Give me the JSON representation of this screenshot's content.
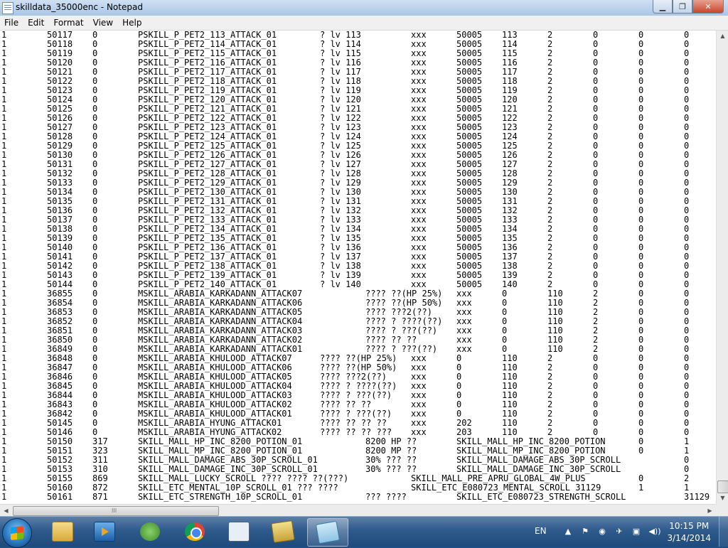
{
  "window": {
    "title": "skilldata_35000enc - Notepad",
    "minimize_glyph": "▁",
    "maximize_glyph": "❐",
    "close_glyph": "✕"
  },
  "menu": [
    "File",
    "Edit",
    "Format",
    "View",
    "Help"
  ],
  "scroll_glyphs": {
    "up": "▲",
    "down": "▼",
    "left": "◀",
    "right": "▶",
    "grip": "III"
  },
  "lines": [
    {
      "cells": [
        "1",
        "50117",
        "0",
        "PSKILL_P_PET2_113_ATTACK_01",
        "? lv 113",
        "xxx",
        "50005",
        "113",
        "2",
        "0",
        "0",
        "0"
      ]
    },
    {
      "cells": [
        "1",
        "50118",
        "0",
        "PSKILL_P_PET2_114_ATTACK_01",
        "? lv 114",
        "xxx",
        "50005",
        "114",
        "2",
        "0",
        "0",
        "0"
      ]
    },
    {
      "cells": [
        "1",
        "50119",
        "0",
        "PSKILL_P_PET2_115_ATTACK_01",
        "? lv 115",
        "xxx",
        "50005",
        "115",
        "2",
        "0",
        "0",
        "0"
      ]
    },
    {
      "cells": [
        "1",
        "50120",
        "0",
        "PSKILL_P_PET2_116_ATTACK_01",
        "? lv 116",
        "xxx",
        "50005",
        "116",
        "2",
        "0",
        "0",
        "0"
      ]
    },
    {
      "cells": [
        "1",
        "50121",
        "0",
        "PSKILL_P_PET2_117_ATTACK_01",
        "? lv 117",
        "xxx",
        "50005",
        "117",
        "2",
        "0",
        "0",
        "0"
      ]
    },
    {
      "cells": [
        "1",
        "50122",
        "0",
        "PSKILL_P_PET2_118_ATTACK_01",
        "? lv 118",
        "xxx",
        "50005",
        "118",
        "2",
        "0",
        "0",
        "0"
      ]
    },
    {
      "cells": [
        "1",
        "50123",
        "0",
        "PSKILL_P_PET2_119_ATTACK_01",
        "? lv 119",
        "xxx",
        "50005",
        "119",
        "2",
        "0",
        "0",
        "0"
      ]
    },
    {
      "cells": [
        "1",
        "50124",
        "0",
        "PSKILL_P_PET2_120_ATTACK_01",
        "? lv 120",
        "xxx",
        "50005",
        "120",
        "2",
        "0",
        "0",
        "0"
      ]
    },
    {
      "cells": [
        "1",
        "50125",
        "0",
        "PSKILL_P_PET2_121_ATTACK_01",
        "? lv 121",
        "xxx",
        "50005",
        "121",
        "2",
        "0",
        "0",
        "0"
      ]
    },
    {
      "cells": [
        "1",
        "50126",
        "0",
        "PSKILL_P_PET2_122_ATTACK_01",
        "? lv 122",
        "xxx",
        "50005",
        "122",
        "2",
        "0",
        "0",
        "0"
      ]
    },
    {
      "cells": [
        "1",
        "50127",
        "0",
        "PSKILL_P_PET2_123_ATTACK_01",
        "? lv 123",
        "xxx",
        "50005",
        "123",
        "2",
        "0",
        "0",
        "0"
      ]
    },
    {
      "cells": [
        "1",
        "50128",
        "0",
        "PSKILL_P_PET2_124_ATTACK_01",
        "? lv 124",
        "xxx",
        "50005",
        "124",
        "2",
        "0",
        "0",
        "0"
      ]
    },
    {
      "cells": [
        "1",
        "50129",
        "0",
        "PSKILL_P_PET2_125_ATTACK_01",
        "? lv 125",
        "xxx",
        "50005",
        "125",
        "2",
        "0",
        "0",
        "0"
      ]
    },
    {
      "cells": [
        "1",
        "50130",
        "0",
        "PSKILL_P_PET2_126_ATTACK_01",
        "? lv 126",
        "xxx",
        "50005",
        "126",
        "2",
        "0",
        "0",
        "0"
      ]
    },
    {
      "cells": [
        "1",
        "50131",
        "0",
        "PSKILL_P_PET2_127_ATTACK_01",
        "? lv 127",
        "xxx",
        "50005",
        "127",
        "2",
        "0",
        "0",
        "0"
      ]
    },
    {
      "cells": [
        "1",
        "50132",
        "0",
        "PSKILL_P_PET2_128_ATTACK_01",
        "? lv 128",
        "xxx",
        "50005",
        "128",
        "2",
        "0",
        "0",
        "0"
      ]
    },
    {
      "cells": [
        "1",
        "50133",
        "0",
        "PSKILL_P_PET2_129_ATTACK_01",
        "? lv 129",
        "xxx",
        "50005",
        "129",
        "2",
        "0",
        "0",
        "0"
      ]
    },
    {
      "cells": [
        "1",
        "50134",
        "0",
        "PSKILL_P_PET2_130_ATTACK_01",
        "? lv 130",
        "xxx",
        "50005",
        "130",
        "2",
        "0",
        "0",
        "0"
      ]
    },
    {
      "cells": [
        "1",
        "50135",
        "0",
        "PSKILL_P_PET2_131_ATTACK_01",
        "? lv 131",
        "xxx",
        "50005",
        "131",
        "2",
        "0",
        "0",
        "0"
      ]
    },
    {
      "cells": [
        "1",
        "50136",
        "0",
        "PSKILL_P_PET2_132_ATTACK_01",
        "? lv 132",
        "xxx",
        "50005",
        "132",
        "2",
        "0",
        "0",
        "0"
      ]
    },
    {
      "cells": [
        "1",
        "50137",
        "0",
        "PSKILL_P_PET2_133_ATTACK_01",
        "? lv 133",
        "xxx",
        "50005",
        "133",
        "2",
        "0",
        "0",
        "0"
      ]
    },
    {
      "cells": [
        "1",
        "50138",
        "0",
        "PSKILL_P_PET2_134_ATTACK_01",
        "? lv 134",
        "xxx",
        "50005",
        "134",
        "2",
        "0",
        "0",
        "0"
      ]
    },
    {
      "cells": [
        "1",
        "50139",
        "0",
        "PSKILL_P_PET2_135_ATTACK_01",
        "? lv 135",
        "xxx",
        "50005",
        "135",
        "2",
        "0",
        "0",
        "0"
      ]
    },
    {
      "cells": [
        "1",
        "50140",
        "0",
        "PSKILL_P_PET2_136_ATTACK_01",
        "? lv 136",
        "xxx",
        "50005",
        "136",
        "2",
        "0",
        "0",
        "0"
      ]
    },
    {
      "cells": [
        "1",
        "50141",
        "0",
        "PSKILL_P_PET2_137_ATTACK_01",
        "? lv 137",
        "xxx",
        "50005",
        "137",
        "2",
        "0",
        "0",
        "0"
      ]
    },
    {
      "cells": [
        "1",
        "50142",
        "0",
        "PSKILL_P_PET2_138_ATTACK_01",
        "? lv 138",
        "xxx",
        "50005",
        "138",
        "2",
        "0",
        "0",
        "0"
      ]
    },
    {
      "cells": [
        "1",
        "50143",
        "0",
        "PSKILL_P_PET2_139_ATTACK_01",
        "? lv 139",
        "xxx",
        "50005",
        "139",
        "2",
        "0",
        "0",
        "0"
      ]
    },
    {
      "cells": [
        "1",
        "50144",
        "0",
        "PSKILL_P_PET2_140_ATTACK_01",
        "? lv 140",
        "xxx",
        "50005",
        "140",
        "2",
        "0",
        "0",
        "0"
      ]
    },
    {
      "cells": [
        "1",
        "36855",
        "0",
        "MSKILL_ARABIA_KARKADANN_ATTACK07",
        "???? ??(HP 25%)",
        "xxx",
        "0",
        "110",
        "2",
        "0",
        "0"
      ]
    },
    {
      "cells": [
        "1",
        "36854",
        "0",
        "MSKILL_ARABIA_KARKADANN_ATTACK06",
        "???? ??(HP 50%)",
        "xxx",
        "0",
        "110",
        "2",
        "0",
        "0"
      ]
    },
    {
      "cells": [
        "1",
        "36853",
        "0",
        "MSKILL_ARABIA_KARKADANN_ATTACK05",
        "???? ???2(??)",
        "xxx",
        "0",
        "110",
        "2",
        "0",
        "0"
      ]
    },
    {
      "cells": [
        "1",
        "36852",
        "0",
        "MSKILL_ARABIA_KARKADANN_ATTACK04",
        "???? ? ????(??)",
        "xxx",
        "0",
        "110",
        "2",
        "0",
        "0"
      ]
    },
    {
      "cells": [
        "1",
        "36851",
        "0",
        "MSKILL_ARABIA_KARKADANN_ATTACK03",
        "???? ? ???(??)",
        "xxx",
        "0",
        "110",
        "2",
        "0",
        "0"
      ]
    },
    {
      "cells": [
        "1",
        "36850",
        "0",
        "MSKILL_ARABIA_KARKADANN_ATTACK02",
        "???? ?? ??",
        "xxx",
        "0",
        "110",
        "2",
        "0",
        "0"
      ]
    },
    {
      "cells": [
        "1",
        "36849",
        "0",
        "MSKILL_ARABIA_KARKADANN_ATTACK01",
        "???? ? ???(??)",
        "xxx",
        "0",
        "110",
        "2",
        "0",
        "0"
      ]
    },
    {
      "cells": [
        "1",
        "36848",
        "0",
        "MSKILL_ARABIA_KHULOOD_ATTACK07",
        "???? ??(HP 25%)",
        "xxx",
        "0",
        "110",
        "2",
        "0",
        "0",
        "0"
      ]
    },
    {
      "cells": [
        "1",
        "36847",
        "0",
        "MSKILL_ARABIA_KHULOOD_ATTACK06",
        "???? ??(HP 50%)",
        "xxx",
        "0",
        "110",
        "2",
        "0",
        "0",
        "0"
      ]
    },
    {
      "cells": [
        "1",
        "36846",
        "0",
        "MSKILL_ARABIA_KHULOOD_ATTACK05",
        "???? ???2(??)",
        "xxx",
        "0",
        "110",
        "2",
        "0",
        "0",
        "0"
      ]
    },
    {
      "cells": [
        "1",
        "36845",
        "0",
        "MSKILL_ARABIA_KHULOOD_ATTACK04",
        "???? ? ????(??)",
        "xxx",
        "0",
        "110",
        "2",
        "0",
        "0",
        "0"
      ]
    },
    {
      "cells": [
        "1",
        "36844",
        "0",
        "MSKILL_ARABIA_KHULOOD_ATTACK03",
        "???? ? ???(??)",
        "xxx",
        "0",
        "110",
        "2",
        "0",
        "0",
        "0"
      ]
    },
    {
      "cells": [
        "1",
        "36843",
        "0",
        "MSKILL_ARABIA_KHULOOD_ATTACK02",
        "???? ?? ??",
        "xxx",
        "0",
        "110",
        "2",
        "0",
        "0",
        "0"
      ]
    },
    {
      "cells": [
        "1",
        "36842",
        "0",
        "MSKILL_ARABIA_KHULOOD_ATTACK01",
        "???? ? ???(??)",
        "xxx",
        "0",
        "110",
        "2",
        "0",
        "0",
        "0"
      ]
    },
    {
      "cells": [
        "1",
        "50145",
        "0",
        "MSKILL_ARABIA_HYUNG_ATTACK01",
        "???? ?? ?? ??",
        "xxx",
        "202",
        "110",
        "2",
        "0",
        "0",
        "0"
      ]
    },
    {
      "cells": [
        "1",
        "50146",
        "0",
        "MSKILL_ARABIA_HYUNG_ATTACK02",
        "???? ?? ?? ???",
        "xxx",
        "203",
        "110",
        "2",
        "0",
        "0",
        "0"
      ]
    },
    {
      "cells": [
        "1",
        "50150",
        "317",
        "SKILL_MALL_HP_INC_8200_POTION_01",
        "8200 HP ??",
        "SKILL_MALL_HP_INC_8200_POTION",
        "0",
        "1"
      ]
    },
    {
      "cells": [
        "1",
        "50151",
        "323",
        "SKILL_MALL_MP_INC_8200_POTION_01",
        "8200 MP ??",
        "SKILL_MALL_MP_INC_8200_POTION",
        "0",
        "1"
      ]
    },
    {
      "cells": [
        "1",
        "50152",
        "311",
        "SKILL_MALL_DAMAGE_ABS_30P_SCROLL_01",
        "30% ??? ??",
        "SKILL_MALL_DAMAGE_ABS_30P_SCROLL",
        "0"
      ]
    },
    {
      "cells": [
        "1",
        "50153",
        "310",
        "SKILL_MALL_DAMAGE_INC_30P_SCROLL_01",
        "30% ??? ??",
        "SKILL_MALL_DAMAGE_INC_30P_SCROLL",
        "0"
      ]
    },
    {
      "cells": [
        "1",
        "50155",
        "869",
        "SKILL_MALL_LUCKY_SCROLL ???? ???? ??(???)",
        "SKILL_MALL_PRE_APRU_GLOBAL_4W_PLUS",
        "0",
        "2"
      ]
    },
    {
      "cells": [
        "1",
        "50160",
        "872",
        "SKILL_ETC_MENTAL_10P_SCROLL_01 ??? ????",
        "SKILL_ETC_E080723_MENTAL_SCROLL 31129",
        "1",
        "1"
      ]
    },
    {
      "cells": [
        "1",
        "50161",
        "871",
        "SKILL_ETC_STRENGTH_10P_SCROLL_01",
        "??? ????",
        "SKILL_ETC_E080723_STRENGTH_SCROLL",
        "31129"
      ]
    }
  ],
  "taskbar": {
    "apps": [
      {
        "name": "explorer",
        "icon": "folder-icon"
      },
      {
        "name": "media-player",
        "icon": "media-icon"
      },
      {
        "name": "network-app",
        "icon": "network-icon"
      },
      {
        "name": "chrome",
        "icon": "chrome-icon"
      },
      {
        "name": "window-app",
        "icon": "window-icon"
      },
      {
        "name": "tools-app",
        "icon": "tools-icon"
      },
      {
        "name": "notepad",
        "icon": "notepad-icon",
        "active": true
      }
    ],
    "language": "EN",
    "tray_glyphs": [
      "▲",
      "⚑",
      "◉",
      "✈",
      "▣",
      "◀))"
    ],
    "time": "10:15 PM",
    "date": "3/14/2014"
  }
}
